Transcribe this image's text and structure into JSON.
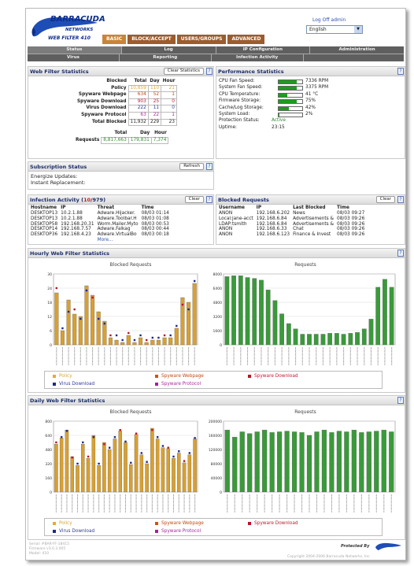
{
  "header": {
    "brand": "BARRACUDA",
    "brand_sub": "NETWORKS",
    "product": "WEB FILTER 410",
    "logoff": "Log Off admin",
    "language": "English"
  },
  "main_tabs": [
    "BASIC",
    "BLOCK/ACCEPT",
    "USERS/GROUPS",
    "ADVANCED"
  ],
  "sub_tabs_row1": [
    "Status",
    "Log",
    "IP Configuration",
    "Administration"
  ],
  "sub_tabs_row2": [
    "Virus",
    "Reporting",
    "Infection Activity"
  ],
  "web_filter": {
    "title": "Web Filter Statistics",
    "clear": "Clear Statistics",
    "headers": [
      "Blocked",
      "Total",
      "Day",
      "Hour"
    ],
    "rows": [
      {
        "label": "Policy",
        "total": "10,859",
        "day": "110",
        "hour": "21"
      },
      {
        "label": "Spyware Webpage",
        "total": "634",
        "day": "52",
        "hour": "1"
      },
      {
        "label": "Spyware Download",
        "total": "903",
        "day": "25",
        "hour": "0"
      },
      {
        "label": "Virus Download",
        "total": "222",
        "day": "11",
        "hour": "0"
      },
      {
        "label": "Spyware Protocol",
        "total": "63",
        "day": "22",
        "hour": "1"
      }
    ],
    "total_blocked": {
      "label": "Total Blocked",
      "total": "11,932",
      "day": "229",
      "hour": "23"
    },
    "req_headers": [
      "Total",
      "Day",
      "Hour"
    ],
    "requests": {
      "label": "Requests",
      "total": "8,817,663",
      "day": "179,831",
      "hour": "7,374"
    }
  },
  "perf": {
    "title": "Performance Statistics",
    "rows": [
      {
        "label": "CPU Fan Speed:",
        "value": "7336 RPM",
        "fill": 0.78
      },
      {
        "label": "System Fan Speed:",
        "value": "3375 RPM",
        "fill": 0.78
      },
      {
        "label": "CPU Temperature:",
        "value": "41 °C",
        "fill": 0.35
      },
      {
        "label": "Firmware Storage:",
        "value": "75%",
        "fill": 0.75
      },
      {
        "label": "Cache/Log Storage:",
        "value": "42%",
        "fill": 0.42
      },
      {
        "label": "System Load:",
        "value": "2%",
        "fill": 0.02
      }
    ],
    "protection_label": "Protection Status:",
    "protection_value": "Active",
    "uptime_label": "Uptime:",
    "uptime_value": "23:15"
  },
  "subscription": {
    "title": "Subscription Status",
    "refresh": "Refresh",
    "lines": [
      "Energize Updates:",
      "Instant Replacement:"
    ]
  },
  "infection": {
    "title_pre": "Infection Activity (",
    "count": "10",
    "title_post": "/979)",
    "clear": "Clear",
    "headers": [
      "Hostname",
      "IP",
      "Threat",
      "Time"
    ],
    "rows": [
      [
        "DESKTOP13",
        "10.2.1.88",
        "Adware.Hijacker.",
        "08/03 01:14"
      ],
      [
        "DESKTOP13",
        "10.2.1.88",
        "Adware.Toolbar.H",
        "08/03 01:08"
      ],
      [
        "DESKTOP58",
        "192.168.20.31",
        "Worm.Mailer.Myto",
        "08/03 00:53"
      ],
      [
        "DESKTOP14",
        "192.168.7.57",
        "Adware.Falkag",
        "08/03 00:44"
      ],
      [
        "DESKTOP36",
        "192.168.4.23",
        "Adware.VirtualBo",
        "08/03 00:18"
      ]
    ],
    "more": "More..."
  },
  "blocked": {
    "title": "Blocked Requests",
    "clear": "Clear",
    "headers": [
      "Username",
      "IP",
      "Last Blocked",
      "Time"
    ],
    "rows": [
      [
        "ANON",
        "192.168.6.202",
        "News",
        "08/03 09:27"
      ],
      [
        "Local:jane-acct",
        "192.168.6.84",
        "Advertisements &",
        "08/03 09:26"
      ],
      [
        "LDAP:tsmith",
        "192.168.6.84",
        "Advertisements &",
        "08/03 09:26"
      ],
      [
        "ANON",
        "192.168.6.33",
        "Chat",
        "08/03 09:26"
      ],
      [
        "ANON",
        "192.168.6.123",
        "Finance & Invest",
        "08/03 09:26"
      ]
    ]
  },
  "hourly": {
    "title": "Hourly Web Filter Statistics"
  },
  "daily": {
    "title": "Daily Web Filter Statistics"
  },
  "legend": [
    {
      "label": "Policy",
      "color": "#e8a838"
    },
    {
      "label": "Spyware Webpage",
      "color": "#c85418"
    },
    {
      "label": "Spyware Download",
      "color": "#c01028"
    },
    {
      "label": "Virus Download",
      "color": "#1c2a8c"
    },
    {
      "label": "Spyware Protocol",
      "color": "#a020a0"
    }
  ],
  "footer": {
    "serial": "Serial: #BAR-YF-18415",
    "firmware": "Firmware v3.0.3.005",
    "model": "Model: 410",
    "protected": "Protected By",
    "copyright": "Copyright 2004-2006 Barracuda Networks, Inc."
  },
  "chart_data": [
    {
      "type": "bar",
      "title": "Blocked Requests",
      "ylim": [
        0,
        30
      ],
      "yticks": [
        "0",
        "6",
        "12",
        "18",
        "24",
        "30"
      ],
      "values": [
        22,
        6,
        19,
        13,
        12,
        25,
        21,
        14,
        10,
        3,
        2,
        1,
        4,
        1,
        3,
        1,
        2,
        2,
        3,
        3,
        7,
        20,
        18,
        26
      ],
      "markers": [
        24,
        7,
        14,
        15,
        11,
        23,
        20,
        11,
        9,
        4,
        4,
        2,
        5,
        2,
        4,
        2,
        3,
        3,
        4,
        4,
        8,
        17,
        15,
        27
      ]
    },
    {
      "type": "bar",
      "title": "Requests",
      "ylim": [
        0,
        8000
      ],
      "yticks": [
        "0",
        "1600",
        "3200",
        "4800",
        "6400",
        "8000"
      ],
      "values": [
        7700,
        7800,
        7800,
        7600,
        7500,
        7300,
        6200,
        5000,
        3500,
        2400,
        1800,
        1200,
        1200,
        1200,
        1200,
        1300,
        1300,
        1200,
        1300,
        1400,
        1800,
        2900,
        6500,
        7400,
        6500
      ]
    },
    {
      "type": "bar",
      "title": "Blocked Requests",
      "ylim": [
        0,
        800
      ],
      "yticks": [
        "0",
        "160",
        "320",
        "480",
        "640",
        "800"
      ],
      "values": [
        540,
        610,
        700,
        400,
        300,
        540,
        380,
        640,
        300,
        560,
        480,
        600,
        690,
        560,
        310,
        650,
        420,
        320,
        720,
        600,
        500,
        490,
        380,
        440,
        330,
        420,
        600
      ],
      "markers": [
        560,
        620,
        690,
        390,
        320,
        560,
        400,
        620,
        320,
        540,
        500,
        620,
        700,
        570,
        330,
        660,
        440,
        340,
        700,
        620,
        520,
        500,
        400,
        460,
        350,
        440,
        610
      ]
    },
    {
      "type": "bar",
      "title": "Requests",
      "ylim": [
        0,
        200000
      ],
      "yticks": [
        "0",
        "40000",
        "80000",
        "120000",
        "160000",
        "200000"
      ],
      "values": [
        175000,
        155000,
        170000,
        165000,
        170000,
        175000,
        168000,
        170000,
        172000,
        170000,
        168000,
        160000,
        170000,
        175000,
        168000,
        172000,
        170000,
        175000,
        168000,
        170000,
        172000,
        175000,
        170000
      ]
    }
  ]
}
